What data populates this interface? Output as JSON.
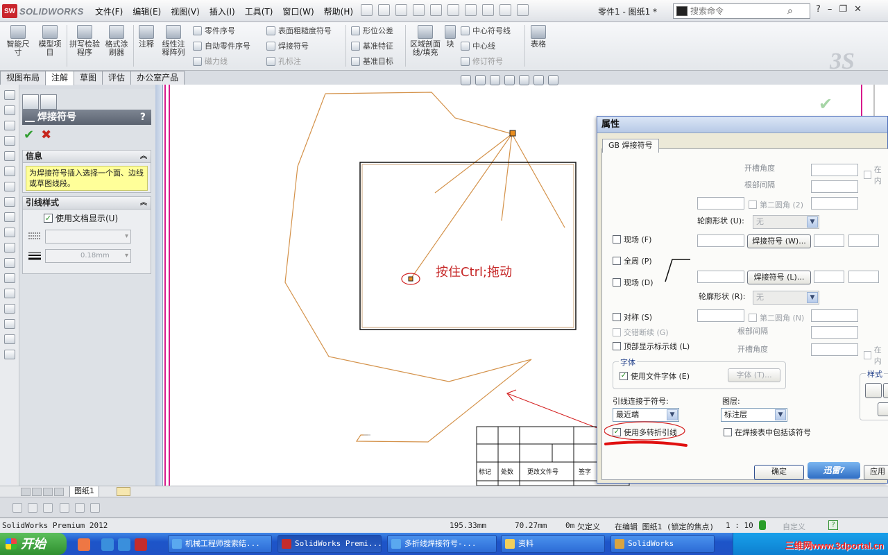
{
  "app": {
    "logo_text": "SOLIDWORKS",
    "logo_mark": "SW",
    "doc_title": "零件1 - 图纸1 *",
    "menu": [
      "文件(F)",
      "编辑(E)",
      "视图(V)",
      "插入(I)",
      "工具(T)",
      "窗口(W)",
      "帮助(H)"
    ],
    "search_placeholder": "搜索命令",
    "window_controls": [
      "?",
      "–",
      "❐",
      "✕"
    ],
    "ds_mark": "3S"
  },
  "commands": {
    "big": [
      {
        "label": "智能尺寸"
      },
      {
        "label": "模型项目"
      },
      {
        "label": "拼写检验程序"
      },
      {
        "label": "格式涂刷器"
      },
      {
        "label": "注释"
      },
      {
        "label": "线性注释阵列"
      },
      {
        "label": "区域剖面线/填充"
      },
      {
        "label": "块"
      },
      {
        "label": "表格"
      }
    ],
    "small": [
      "零件序号",
      "自动零件序号",
      "磁力线",
      "表面粗糙度符号",
      "焊接符号",
      "孔标注",
      "形位公差",
      "基准特征",
      "基准目标",
      "中心符号线",
      "中心线",
      "修订符号"
    ]
  },
  "tabs": [
    "视图布局",
    "注解",
    "草图",
    "评估",
    "办公室产品"
  ],
  "property_manager": {
    "title": "焊接符号",
    "help": "?",
    "info_header": "信息",
    "info_text": "为焊接符号插入选择一个面、边线或草图线段。",
    "leader_header": "引线样式",
    "use_doc_display": "使用文档显示(U)",
    "use_doc_display_checked": true,
    "line_weight": "0.18mm"
  },
  "canvas": {
    "annotation_text": "按住Ctrl;拖动",
    "title_block_labels": [
      "标记",
      "处数",
      "更改文件号",
      "签字"
    ]
  },
  "dialog": {
    "title": "属性",
    "tab": "GB 焊接符号",
    "labels": {
      "groove_angle_top": "开槽角度",
      "root_gap_top": "根部间隔",
      "second_fillet_top": "第二圆角 (2)",
      "contour_top": "轮廓形状 (U):",
      "contour_top_value": "无",
      "field_weld_top": "现场 (F)",
      "weld_symbol_top": "焊接符号 (W)...",
      "all_around": "全周 (P)",
      "field_weld_bottom": "现场 (D)",
      "weld_symbol_bottom": "焊接符号 (L)...",
      "contour_bottom": "轮廓形状 (R):",
      "contour_bottom_value": "无",
      "symmetric": "对称 (S)",
      "second_fillet_bottom": "第二圆角 (N)",
      "staggered": "交错断续 (G)",
      "root_gap_bottom": "根部间隔",
      "top_display_ref": "顶部显示标示线 (L)",
      "groove_angle_bottom": "开槽角度",
      "inside_top": "在内",
      "inside_bottom": "在内",
      "font_group": "字体",
      "use_doc_font": "使用文件字体 (E)",
      "font_button": "字体 (T)...",
      "style_group": "样式",
      "leader_anchor": "引线连接于符号:",
      "leader_anchor_value": "最近端",
      "layer": "图层:",
      "layer_value": "标注层",
      "use_multijog": "使用多转折引线",
      "include_in_table": "在焊接表中包括该符号",
      "ok": "确定",
      "apply": "应用"
    },
    "use_doc_font_checked": true,
    "use_multijog_checked": true,
    "xunlei": "迅雷7"
  },
  "sheet_tab": "图纸1",
  "statusbar": {
    "product": "SolidWorks Premium 2012",
    "x": "195.33mm",
    "y": "70.27mm",
    "z": "0m",
    "state": "欠定义",
    "edit": "在编辑 图纸1 (锁定的焦点)",
    "scale": "1 : 10",
    "custom": "自定义"
  },
  "taskbar": {
    "start": "开始",
    "tasks": [
      "机械工程师搜索结...",
      "SolidWorks Premi...",
      "多折线焊接符号-...",
      "资料",
      "SolidWorks"
    ],
    "watermark": "三维网www.3dportal.cn"
  }
}
